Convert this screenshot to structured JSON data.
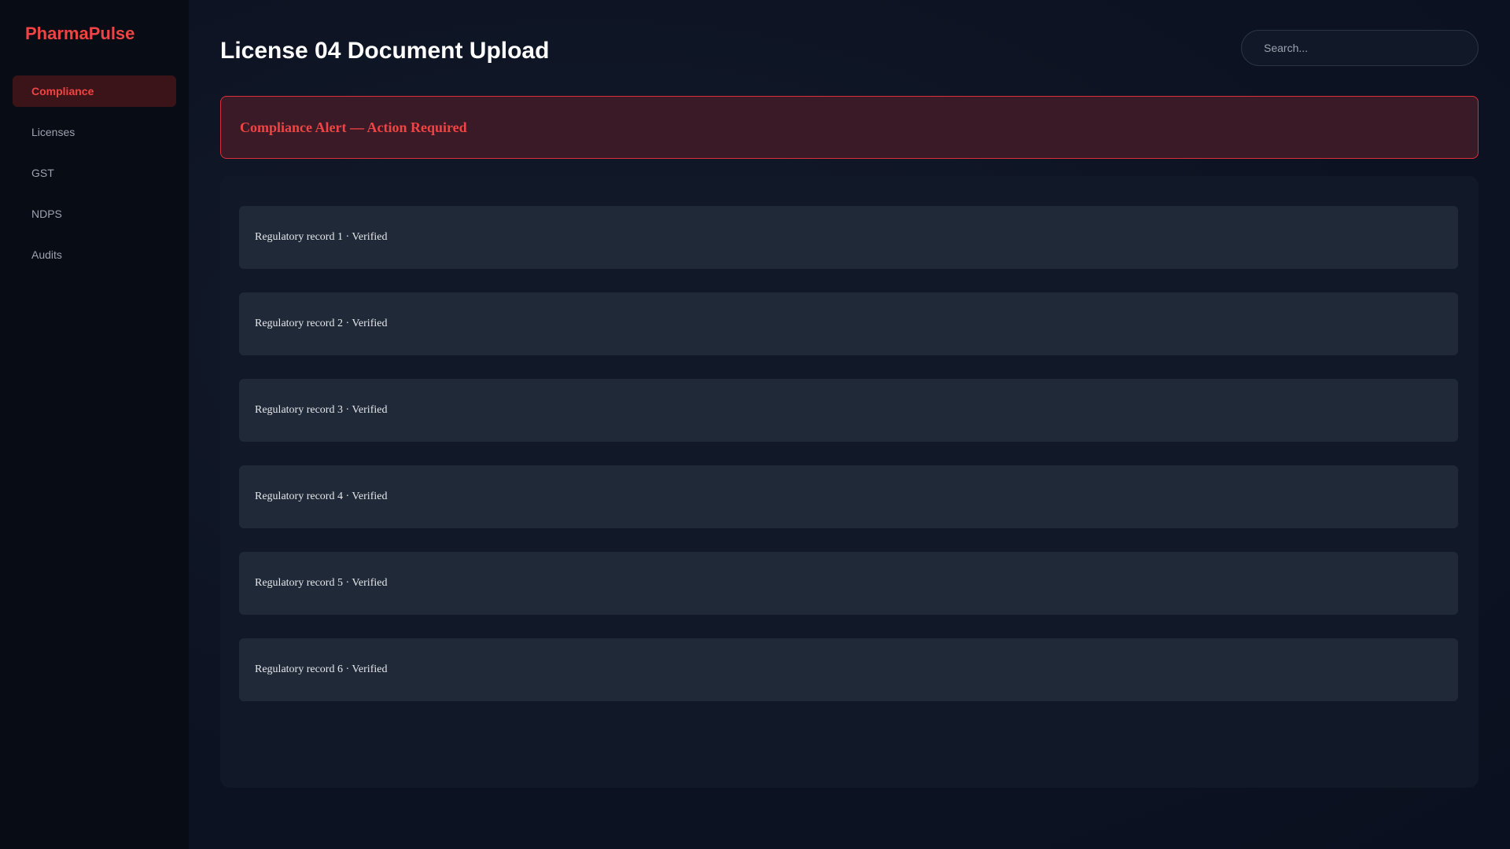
{
  "app": {
    "brand": "PharmaPulse"
  },
  "sidebar": {
    "items": [
      {
        "label": "Compliance",
        "active": true
      },
      {
        "label": "Licenses",
        "active": false
      },
      {
        "label": "GST",
        "active": false
      },
      {
        "label": "NDPS",
        "active": false
      },
      {
        "label": "Audits",
        "active": false
      }
    ]
  },
  "header": {
    "title": "License 04 Document Upload",
    "search_placeholder": "Search..."
  },
  "alert": {
    "title": "Compliance Alert — Action Required"
  },
  "records": [
    {
      "text": "Regulatory record 1 · Verified"
    },
    {
      "text": "Regulatory record 2 · Verified"
    },
    {
      "text": "Regulatory record 3 · Verified"
    },
    {
      "text": "Regulatory record 4 · Verified"
    },
    {
      "text": "Regulatory record 5 · Verified"
    },
    {
      "text": "Regulatory record 6 · Verified"
    }
  ],
  "colors": {
    "accent": "#ef4444",
    "alert_bg": "#3b1a28",
    "sidebar_bg": "#080c15",
    "card_bg": "#1f2937"
  }
}
